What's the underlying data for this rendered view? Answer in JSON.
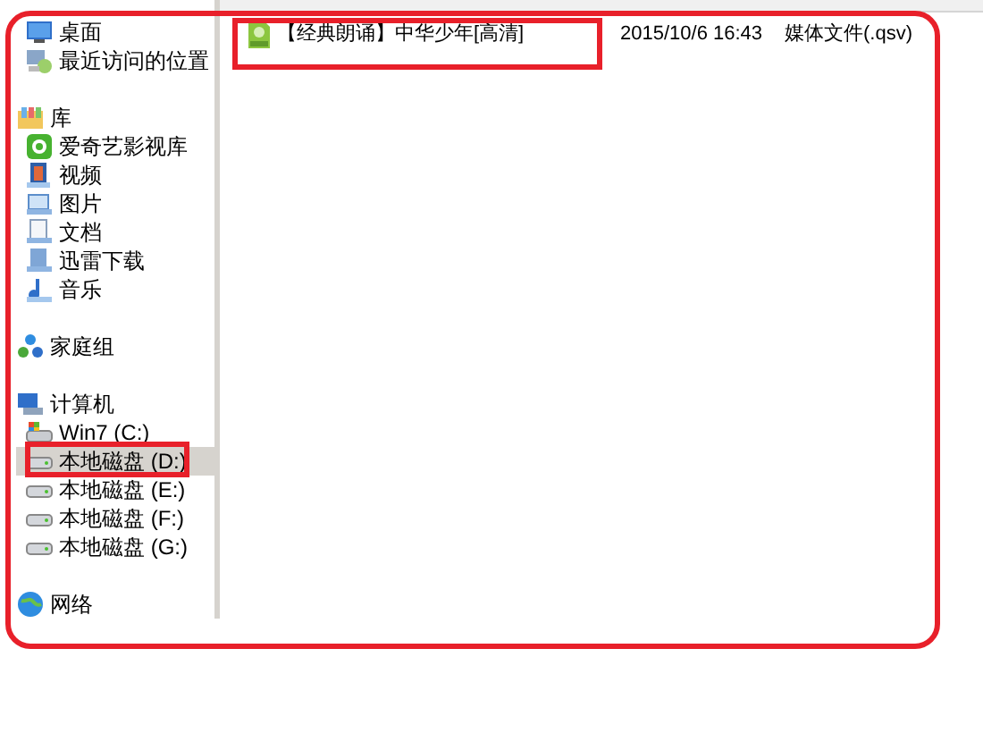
{
  "navigation": [
    {
      "children": [
        {
          "label": "桌面",
          "kind": "desktop",
          "selected": false
        },
        {
          "label": "最近访问的位置",
          "kind": "recent",
          "selected": false
        }
      ]
    },
    {
      "label": "库",
      "kind": "library",
      "children": [
        {
          "label": "爱奇艺影视库",
          "kind": "app",
          "selected": false
        },
        {
          "label": "视频",
          "kind": "video",
          "selected": false
        },
        {
          "label": "图片",
          "kind": "picture",
          "selected": false
        },
        {
          "label": "文档",
          "kind": "document",
          "selected": false
        },
        {
          "label": "迅雷下载",
          "kind": "download",
          "selected": false
        },
        {
          "label": "音乐",
          "kind": "music",
          "selected": false
        }
      ]
    },
    {
      "label": "家庭组",
      "kind": "homegroup"
    },
    {
      "label": "计算机",
      "kind": "computer",
      "children": [
        {
          "label": "Win7 (C:)",
          "kind": "system-drive",
          "selected": false
        },
        {
          "label": "本地磁盘 (D:)",
          "kind": "drive",
          "selected": true
        },
        {
          "label": "本地磁盘 (E:)",
          "kind": "drive",
          "selected": false
        },
        {
          "label": "本地磁盘 (F:)",
          "kind": "drive",
          "selected": false
        },
        {
          "label": "本地磁盘 (G:)",
          "kind": "drive",
          "selected": false
        }
      ]
    },
    {
      "label": "网络",
      "kind": "network"
    }
  ],
  "files": [
    {
      "name": "【经典朗诵】中华少年[高清]",
      "modified": "2015/10/6 16:43",
      "type": "媒体文件(.qsv)"
    }
  ]
}
